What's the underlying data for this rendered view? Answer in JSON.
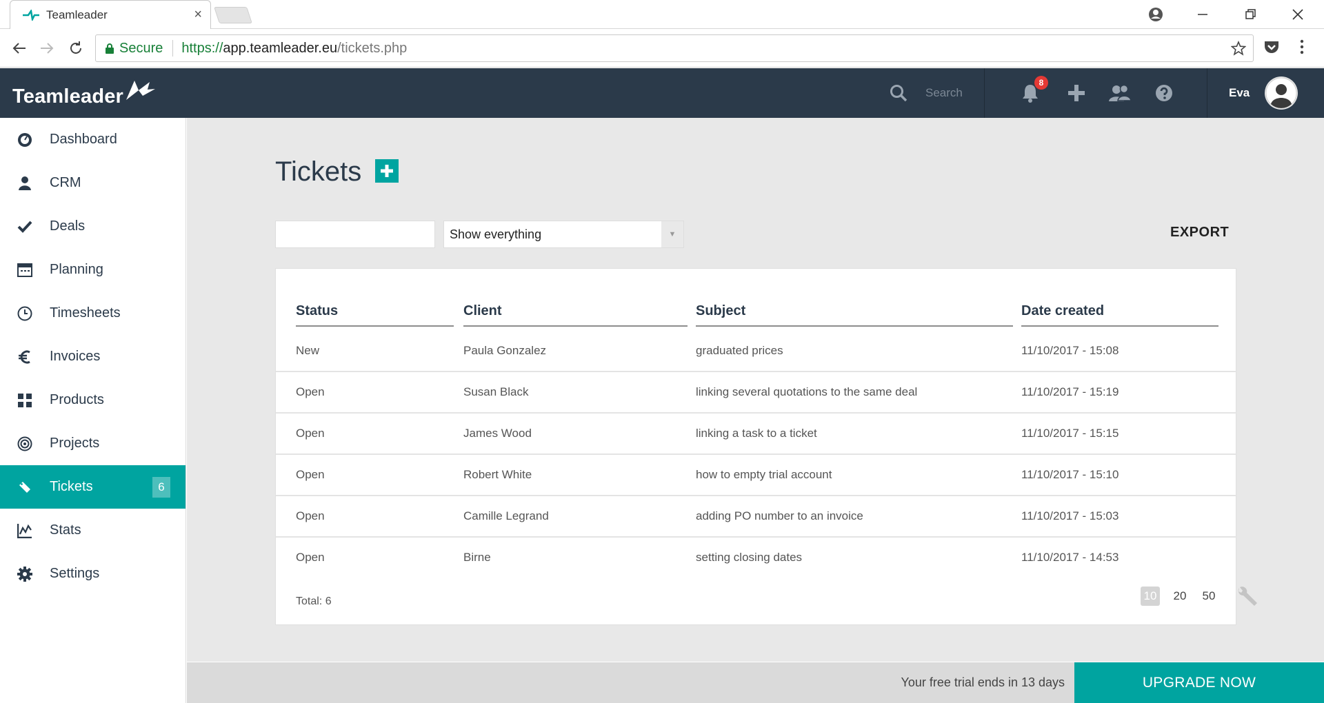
{
  "browser": {
    "tab_title": "Teamleader",
    "secure_label": "Secure",
    "url_scheme": "https://",
    "url_host": "app.teamleader.eu",
    "url_path": "/tickets.php"
  },
  "header": {
    "logo_text": "Teamleader",
    "search_placeholder": "Search",
    "notification_count": "8",
    "user_name": "Eva",
    "bg_color": "#2b3a4a"
  },
  "sidebar": {
    "accent_color": "#00a4a0",
    "items": [
      {
        "label": "Dashboard",
        "icon": "dashboard-icon"
      },
      {
        "label": "CRM",
        "icon": "person-icon"
      },
      {
        "label": "Deals",
        "icon": "checkmark-icon"
      },
      {
        "label": "Planning",
        "icon": "calendar-icon"
      },
      {
        "label": "Timesheets",
        "icon": "clock-icon"
      },
      {
        "label": "Invoices",
        "icon": "euro-icon"
      },
      {
        "label": "Products",
        "icon": "grid-icon"
      },
      {
        "label": "Projects",
        "icon": "target-icon"
      },
      {
        "label": "Tickets",
        "icon": "ticket-icon",
        "count": "6",
        "active": true
      },
      {
        "label": "Stats",
        "icon": "stats-icon"
      },
      {
        "label": "Settings",
        "icon": "gear-icon"
      }
    ]
  },
  "main": {
    "title": "Tickets",
    "search_placeholder": "",
    "filter_value": "Show everything",
    "export_label": "EXPORT",
    "table": {
      "columns": [
        "Status",
        "Client",
        "Subject",
        "Date created"
      ],
      "rows": [
        [
          "New",
          "Paula Gonzalez",
          "graduated prices",
          "11/10/2017 - 15:08"
        ],
        [
          "Open",
          "Susan Black",
          "linking several quotations to the same deal",
          "11/10/2017 - 15:19"
        ],
        [
          "Open",
          "James Wood",
          "linking a task to a ticket",
          "11/10/2017 - 15:15"
        ],
        [
          "Open",
          "Robert White",
          "how to empty trial account",
          "11/10/2017 - 15:10"
        ],
        [
          "Open",
          "Camille Legrand",
          "adding PO number to an invoice",
          "11/10/2017 - 15:03"
        ],
        [
          "Open",
          "Birne",
          "setting closing dates",
          "11/10/2017 - 14:53"
        ]
      ]
    },
    "total_label": "Total: 6",
    "page_sizes": [
      "10",
      "20",
      "50"
    ],
    "selected_page_size": "10"
  },
  "trial": {
    "message": "Your free trial ends in 13 days",
    "upgrade_label": "UPGRADE NOW"
  }
}
